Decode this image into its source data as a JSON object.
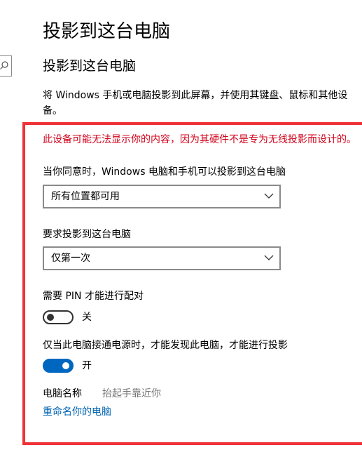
{
  "page": {
    "title": "投影到这台电脑",
    "section_title": "投影到这台电脑",
    "description": "将 Windows 手机或电脑投影到此屏幕，并使用其键盘、鼠标和其他设备。"
  },
  "settings": {
    "warning": "此设备可能无法显示你的内容，因为其硬件不是专为无线投影而设计的。",
    "availability": {
      "label": "当你同意时，Windows 电脑和手机可以投影到这台电脑",
      "selected": "所有位置都可用"
    },
    "ask_to_project": {
      "label": "要求投影到这台电脑",
      "selected": "仅第一次"
    },
    "require_pin": {
      "label": "需要 PIN 才能进行配对",
      "state_label": "关",
      "on": false
    },
    "power_only": {
      "label": "仅当此电脑接通电源时，才能发现此电脑，才能进行投影",
      "state_label": "开",
      "on": true
    },
    "pc_name": {
      "label": "电脑名称",
      "value": "抬起手靠近你"
    },
    "rename_link": "重命名你的电脑"
  },
  "icons": {
    "search": "search-icon",
    "dropdown": "chevron-down-icon"
  },
  "colors": {
    "accent": "#0067c0",
    "warning": "#d0021b",
    "highlight_frame": "#ef3338",
    "link": "#0063b1"
  }
}
